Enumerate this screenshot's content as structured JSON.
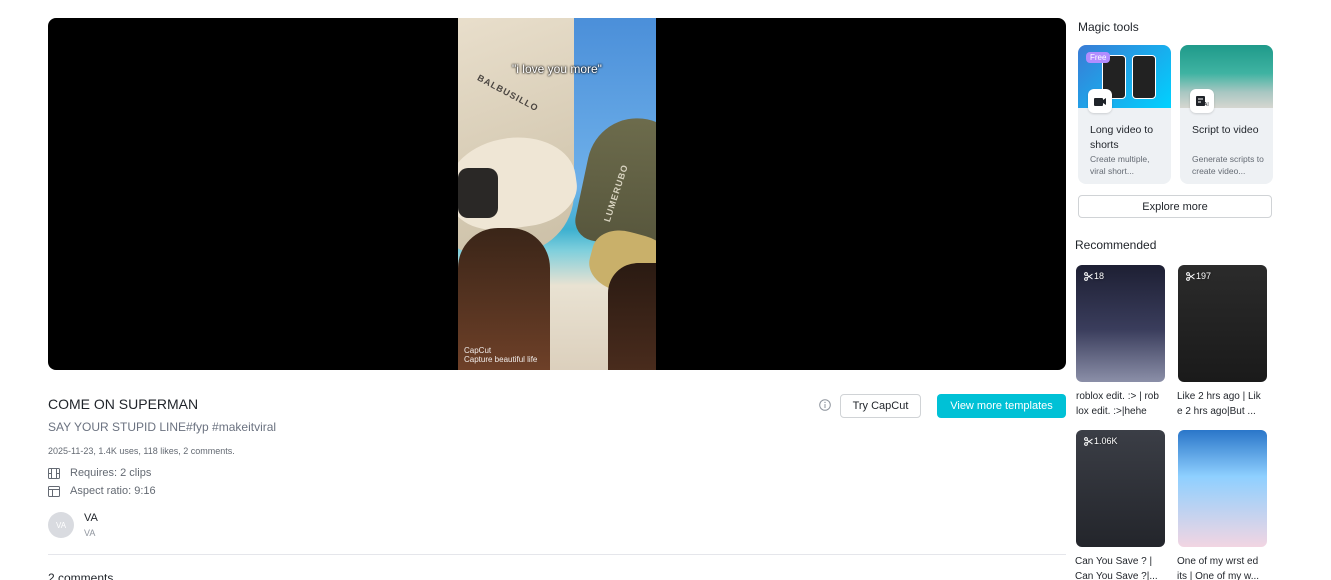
{
  "video": {
    "caption": "\"i love you more\"",
    "hat_text_left": "BALBUSILLO",
    "hat_text_right": "LUMERUBO",
    "watermark_line1": "CapCut",
    "watermark_line2": "Capture beautiful life"
  },
  "template": {
    "title": "COME ON SUPERMAN",
    "subtitle": "SAY YOUR STUPID LINE#fyp #makeitviral",
    "meta": "2025-11-23, 1.4K uses, 118 likes, 2 comments.",
    "requires": "Requires: 2 clips",
    "aspect_ratio": "Aspect ratio: 9:16",
    "author_initials": "VA",
    "author_name": "VA",
    "author_handle": "VA",
    "comments_label": "2 comments"
  },
  "actions": {
    "try_label": "Try CapCut",
    "more_label": "View more templates"
  },
  "magic_tools": {
    "heading": "Magic tools",
    "cards": [
      {
        "name": "Long video to shorts",
        "desc": "Create multiple, viral short...",
        "badge": "Free",
        "icon": "video-cut-icon"
      },
      {
        "name": "Script to video",
        "desc": "Generate scripts to create video...",
        "icon": "ai-script-icon"
      }
    ],
    "explore_label": "Explore more"
  },
  "recommended": {
    "heading": "Recommended",
    "items": [
      {
        "usage": "18",
        "caption": "roblox edit. :> | rob lox edit. :>|hehe"
      },
      {
        "usage": "197",
        "caption": "Like 2 hrs ago | Lik e 2 hrs ago|But ..."
      },
      {
        "usage": "1.06K",
        "caption": "Can You Save ? | Can You Save ?|..."
      },
      {
        "usage": "",
        "caption": "One of my wrst ed its | One of my w..."
      }
    ]
  },
  "colors": {
    "accent": "#00c1d6",
    "text_primary": "#1f2329",
    "text_secondary": "#646a73"
  }
}
